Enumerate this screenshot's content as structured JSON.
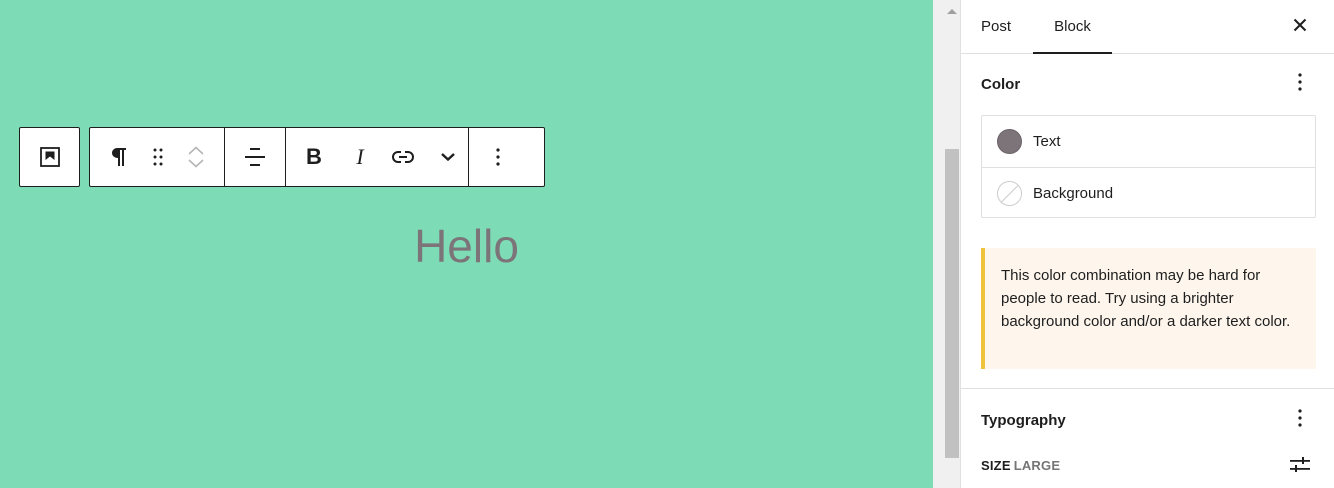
{
  "canvas": {
    "background": "#7ddcb6",
    "paragraph_text": "Hello",
    "text_color": "#7c7479"
  },
  "toolbar": {
    "icons": [
      "block-parent-icon",
      "paragraph-icon",
      "drag-handle-icon",
      "chevron-up-icon",
      "chevron-down-icon",
      "align-center-icon",
      "bold-icon",
      "italic-icon",
      "link-icon",
      "more-rich-text-chevron-icon",
      "more-options-icon"
    ],
    "bold_label": "B",
    "italic_label": "I"
  },
  "sidebar": {
    "tabs": [
      {
        "label": "Post",
        "active": false
      },
      {
        "label": "Block",
        "active": true
      }
    ],
    "color_panel": {
      "title": "Color",
      "items": [
        {
          "label": "Text",
          "swatch": "#7c7479"
        },
        {
          "label": "Background",
          "swatch": "none"
        }
      ],
      "notice": "This color combination may be hard for people to read. Try using a brighter background color and/or a darker text color.",
      "notice_accent": "#f0c33c"
    },
    "typography_panel": {
      "title": "Typography",
      "size_label": "SIZE",
      "size_value": "LARGE"
    }
  }
}
